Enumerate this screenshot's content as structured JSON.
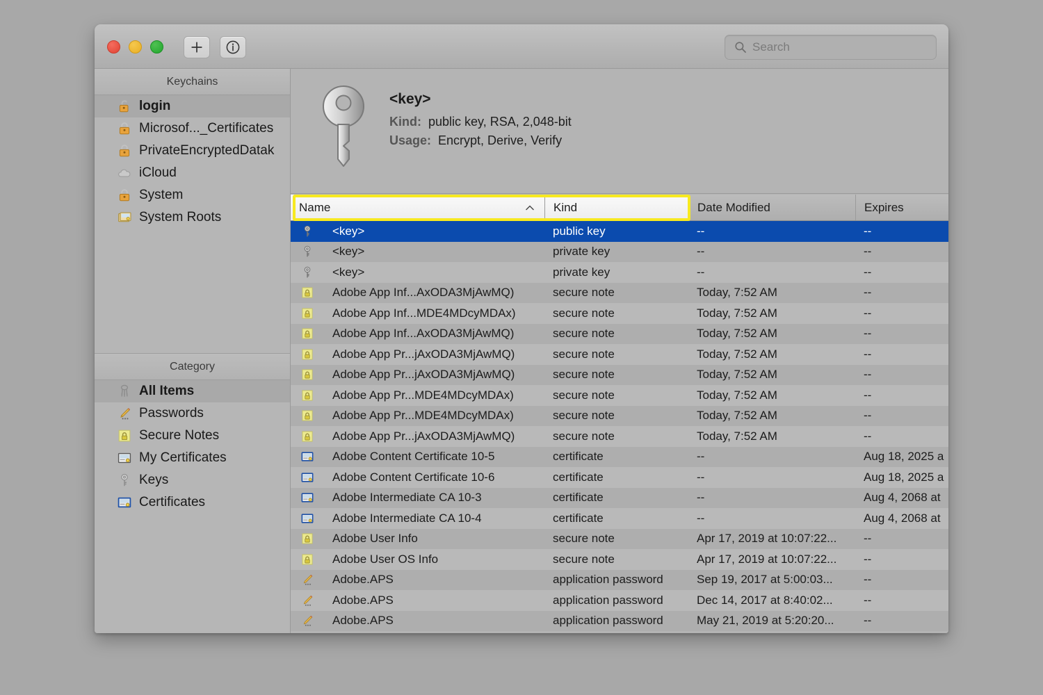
{
  "window": {
    "traffic_lights": [
      "close",
      "minimize",
      "zoom"
    ],
    "toolbar": {
      "add_label": "+",
      "add_icon": "plus-icon",
      "info_icon": "info-circle-icon"
    },
    "search": {
      "placeholder": "Search",
      "value": "",
      "icon": "search-icon"
    }
  },
  "sidebar": {
    "keychains_header": "Keychains",
    "keychains": [
      {
        "label": "login",
        "icon": "unlocked-padlock-icon",
        "selected": true
      },
      {
        "label": "Microsof..._Certificates",
        "icon": "locked-padlock-icon",
        "selected": false
      },
      {
        "label": "PrivateEncryptedDatak",
        "icon": "locked-padlock-icon",
        "selected": false
      },
      {
        "label": "iCloud",
        "icon": "cloud-icon",
        "selected": false
      },
      {
        "label": "System",
        "icon": "locked-padlock-icon",
        "selected": false
      },
      {
        "label": "System Roots",
        "icon": "certificate-stack-icon",
        "selected": false
      }
    ],
    "category_header": "Category",
    "categories": [
      {
        "label": "All Items",
        "icon": "keyring-icon",
        "selected": true
      },
      {
        "label": "Passwords",
        "icon": "pencil-password-icon",
        "selected": false
      },
      {
        "label": "Secure Notes",
        "icon": "secure-note-icon",
        "selected": false
      },
      {
        "label": "My Certificates",
        "icon": "my-certificate-icon",
        "selected": false
      },
      {
        "label": "Keys",
        "icon": "key-icon",
        "selected": false
      },
      {
        "label": "Certificates",
        "icon": "certificate-icon",
        "selected": false
      }
    ]
  },
  "detail": {
    "icon": "large-key-icon",
    "title": "<key>",
    "kind_label": "Kind:",
    "kind_value": "public key, RSA, 2,048-bit",
    "usage_label": "Usage:",
    "usage_value": "Encrypt, Derive, Verify"
  },
  "table": {
    "columns": [
      {
        "key": "name",
        "label": "Name",
        "sorted": true,
        "sort_direction": "ascending",
        "sort_icon": "chevron-up-icon",
        "highlighted": true
      },
      {
        "key": "kind",
        "label": "Kind",
        "sorted": false,
        "highlighted": true
      },
      {
        "key": "date_modified",
        "label": "Date Modified",
        "sorted": false,
        "highlighted": false
      },
      {
        "key": "expires",
        "label": "Expires",
        "sorted": false,
        "highlighted": false
      }
    ],
    "highlight_color": "#f7e920",
    "selection_color": "#0b4bae",
    "rows": [
      {
        "icon": "key-icon",
        "name": "<key>",
        "kind": "public key",
        "date_modified": "--",
        "expires": "--",
        "selected": true
      },
      {
        "icon": "key-icon",
        "name": "<key>",
        "kind": "private key",
        "date_modified": "--",
        "expires": "--",
        "selected": false
      },
      {
        "icon": "key-icon",
        "name": "<key>",
        "kind": "private key",
        "date_modified": "--",
        "expires": "--",
        "selected": false
      },
      {
        "icon": "secure-note-icon",
        "name": "Adobe App Inf...AxODA3MjAwMQ)",
        "kind": "secure note",
        "date_modified": "Today, 7:52 AM",
        "expires": "--",
        "selected": false
      },
      {
        "icon": "secure-note-icon",
        "name": "Adobe App Inf...MDE4MDcyMDAx)",
        "kind": "secure note",
        "date_modified": "Today, 7:52 AM",
        "expires": "--",
        "selected": false
      },
      {
        "icon": "secure-note-icon",
        "name": "Adobe App Inf...AxODA3MjAwMQ)",
        "kind": "secure note",
        "date_modified": "Today, 7:52 AM",
        "expires": "--",
        "selected": false
      },
      {
        "icon": "secure-note-icon",
        "name": "Adobe App Pr...jAxODA3MjAwMQ)",
        "kind": "secure note",
        "date_modified": "Today, 7:52 AM",
        "expires": "--",
        "selected": false
      },
      {
        "icon": "secure-note-icon",
        "name": "Adobe App Pr...jAxODA3MjAwMQ)",
        "kind": "secure note",
        "date_modified": "Today, 7:52 AM",
        "expires": "--",
        "selected": false
      },
      {
        "icon": "secure-note-icon",
        "name": "Adobe App Pr...MDE4MDcyMDAx)",
        "kind": "secure note",
        "date_modified": "Today, 7:52 AM",
        "expires": "--",
        "selected": false
      },
      {
        "icon": "secure-note-icon",
        "name": "Adobe App Pr...MDE4MDcyMDAx)",
        "kind": "secure note",
        "date_modified": "Today, 7:52 AM",
        "expires": "--",
        "selected": false
      },
      {
        "icon": "secure-note-icon",
        "name": "Adobe App Pr...jAxODA3MjAwMQ)",
        "kind": "secure note",
        "date_modified": "Today, 7:52 AM",
        "expires": "--",
        "selected": false
      },
      {
        "icon": "certificate-icon",
        "name": "Adobe Content Certificate 10-5",
        "kind": "certificate",
        "date_modified": "--",
        "expires": "Aug 18, 2025 a",
        "selected": false
      },
      {
        "icon": "certificate-icon",
        "name": "Adobe Content Certificate 10-6",
        "kind": "certificate",
        "date_modified": "--",
        "expires": "Aug 18, 2025 a",
        "selected": false
      },
      {
        "icon": "certificate-icon",
        "name": "Adobe Intermediate CA 10-3",
        "kind": "certificate",
        "date_modified": "--",
        "expires": "Aug 4, 2068 at",
        "selected": false
      },
      {
        "icon": "certificate-icon",
        "name": "Adobe Intermediate CA 10-4",
        "kind": "certificate",
        "date_modified": "--",
        "expires": "Aug 4, 2068 at",
        "selected": false
      },
      {
        "icon": "secure-note-icon",
        "name": "Adobe User Info",
        "kind": "secure note",
        "date_modified": "Apr 17, 2019 at 10:07:22...",
        "expires": "--",
        "selected": false
      },
      {
        "icon": "secure-note-icon",
        "name": "Adobe User OS Info",
        "kind": "secure note",
        "date_modified": "Apr 17, 2019 at 10:07:22...",
        "expires": "--",
        "selected": false
      },
      {
        "icon": "pencil-password-icon",
        "name": "Adobe.APS",
        "kind": "application password",
        "date_modified": "Sep 19, 2017 at 5:00:03...",
        "expires": "--",
        "selected": false
      },
      {
        "icon": "pencil-password-icon",
        "name": "Adobe.APS",
        "kind": "application password",
        "date_modified": "Dec 14, 2017 at 8:40:02...",
        "expires": "--",
        "selected": false
      },
      {
        "icon": "pencil-password-icon",
        "name": "Adobe.APS",
        "kind": "application password",
        "date_modified": "May 21, 2019 at 5:20:20...",
        "expires": "--",
        "selected": false
      }
    ]
  }
}
